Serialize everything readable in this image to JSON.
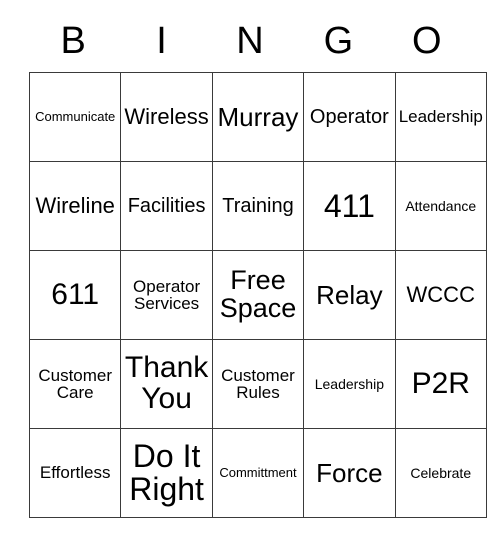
{
  "card": {
    "type": "bingo-card",
    "header_letters": [
      "B",
      "I",
      "N",
      "G",
      "O"
    ],
    "grid_size": "5x5",
    "free_space_cell": {
      "row": 3,
      "column": 3,
      "text": "Free Space"
    },
    "colors": {
      "background": "#ffffff",
      "text": "#000000",
      "grid_line": "#3a3a3a"
    },
    "rows": [
      [
        {
          "text": "Communicate",
          "size": "xs"
        },
        {
          "text": "Wireless",
          "size": "xl"
        },
        {
          "text": "Murray",
          "size": "2xl"
        },
        {
          "text": "Operator",
          "size": "lg"
        },
        {
          "text": "Leadership",
          "size": "md"
        }
      ],
      [
        {
          "text": "Wireline",
          "size": "xl"
        },
        {
          "text": "Facilities",
          "size": "lg"
        },
        {
          "text": "Training",
          "size": "lg"
        },
        {
          "text": "411",
          "size": "5xl"
        },
        {
          "text": "Attendance",
          "size": "sm"
        }
      ],
      [
        {
          "text": "611",
          "size": "4xl"
        },
        {
          "text": "Operator\nServices",
          "size": "md"
        },
        {
          "text": "Free\nSpace",
          "size": "3xl"
        },
        {
          "text": "Relay",
          "size": "2xl"
        },
        {
          "text": "WCCC",
          "size": "xl"
        }
      ],
      [
        {
          "text": "Customer\nCare",
          "size": "md"
        },
        {
          "text": "Thank\nYou",
          "size": "4xl"
        },
        {
          "text": "Customer\nRules",
          "size": "md"
        },
        {
          "text": "Leadership",
          "size": "sm"
        },
        {
          "text": "P2R",
          "size": "4xl"
        }
      ],
      [
        {
          "text": "Effortless",
          "size": "md"
        },
        {
          "text": "Do It\nRight",
          "size": "5xl"
        },
        {
          "text": "Committment",
          "size": "xs"
        },
        {
          "text": "Force",
          "size": "2xl"
        },
        {
          "text": "Celebrate",
          "size": "sm"
        }
      ]
    ]
  }
}
